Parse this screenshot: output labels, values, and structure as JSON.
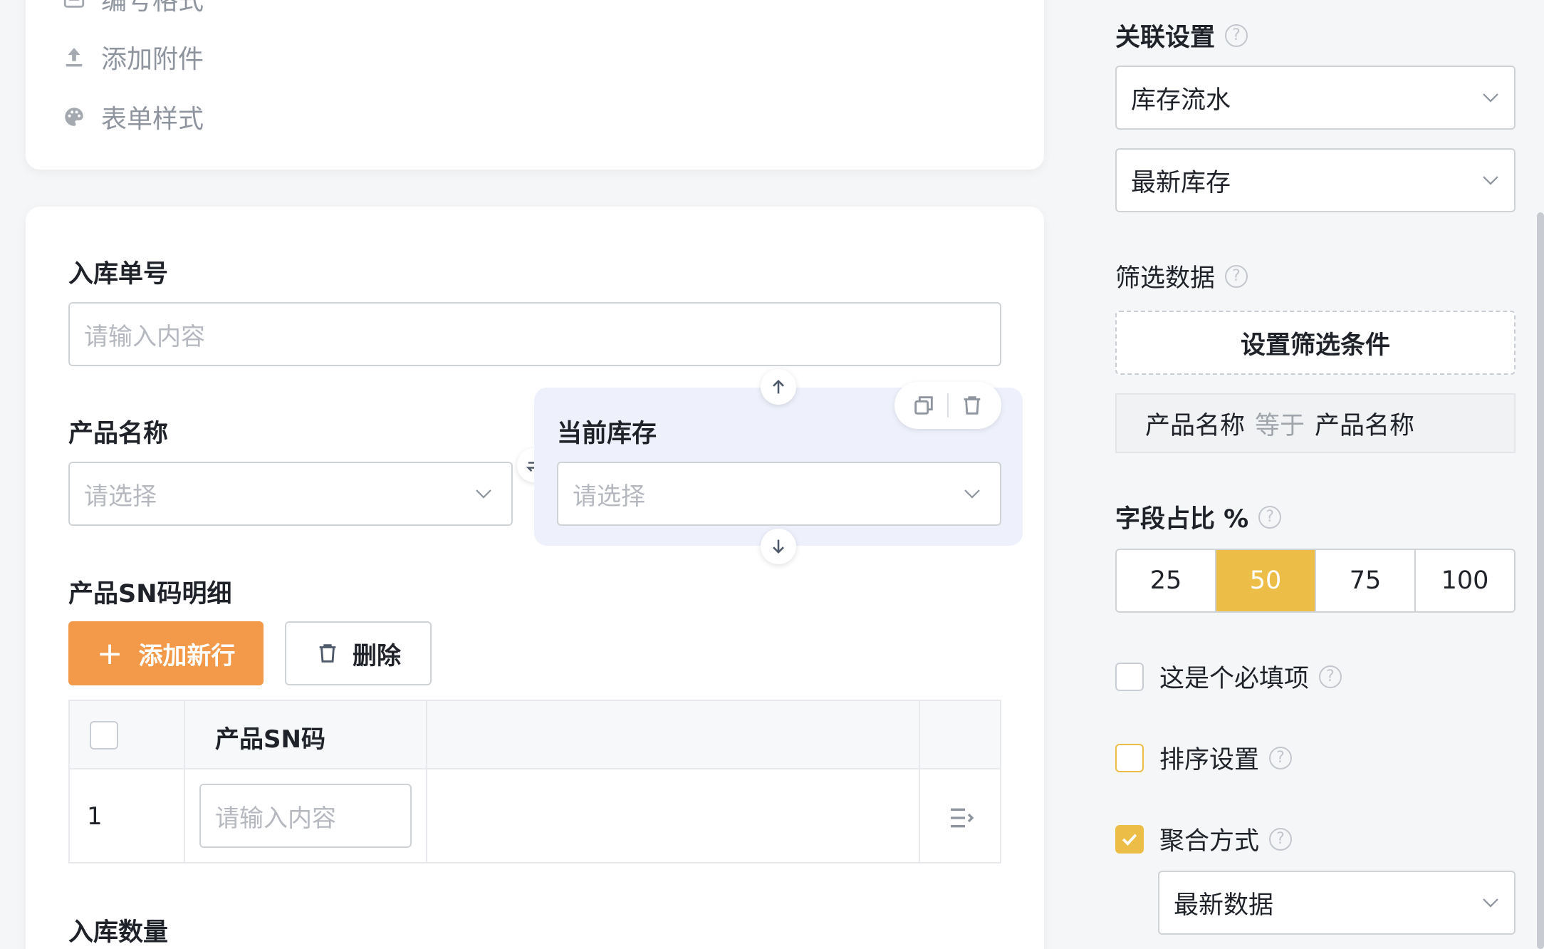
{
  "sidebar_menu": {
    "items": [
      {
        "label": "编号格式",
        "icon": "number-format-icon"
      },
      {
        "label": "添加附件",
        "icon": "upload-icon"
      },
      {
        "label": "表单样式",
        "icon": "palette-icon"
      }
    ]
  },
  "form": {
    "inbound_no": {
      "label": "入库单号",
      "placeholder": "请输入内容"
    },
    "product_name": {
      "label": "产品名称",
      "placeholder": "请选择"
    },
    "current_stock": {
      "label": "当前库存",
      "placeholder": "请选择"
    },
    "sn_detail": {
      "label": "产品SN码明细",
      "add_button": "添加新行",
      "delete_button": "删除",
      "columns": [
        "产品SN码"
      ],
      "rows": [
        {
          "index": "1",
          "sn_placeholder": "请输入内容"
        }
      ]
    },
    "inbound_qty": {
      "label": "入库数量"
    }
  },
  "panel": {
    "relation": {
      "label": "关联设置",
      "source": "库存流水",
      "field": "最新库存"
    },
    "filter": {
      "label": "筛选数据",
      "button": "设置筛选条件",
      "condition": {
        "left": "产品名称",
        "op": "等于",
        "right": "产品名称"
      }
    },
    "width": {
      "label": "字段占比 %",
      "options": [
        "25",
        "50",
        "75",
        "100"
      ],
      "selected": "50"
    },
    "required": {
      "label": "这是个必填项",
      "checked": false
    },
    "sort": {
      "label": "排序设置",
      "checked": false
    },
    "aggregate": {
      "label": "聚合方式",
      "checked": true,
      "value": "最新数据"
    }
  },
  "colors": {
    "accent_orange": "#f3994a",
    "accent_yellow": "#ecbe48",
    "selected_bg": "#eef1fb"
  }
}
